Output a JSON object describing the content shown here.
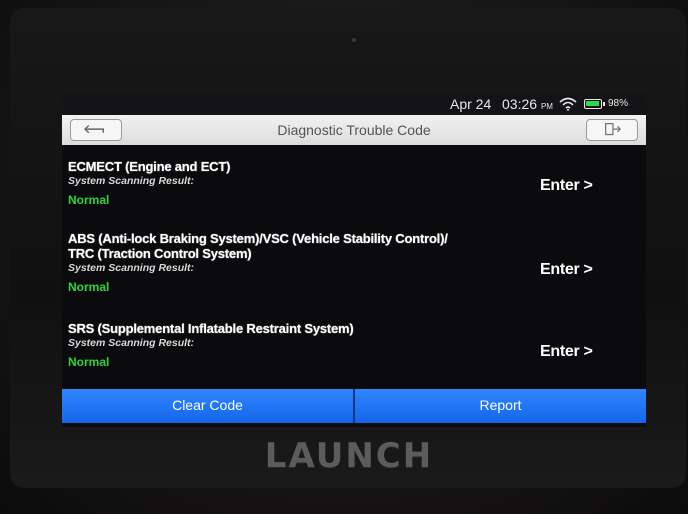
{
  "status_bar": {
    "date": "Apr 24",
    "time": "03:26",
    "time_suffix": "PM",
    "battery_level_percent": 98,
    "battery_label": "98%"
  },
  "header": {
    "title": "Diagnostic Trouble Code",
    "back_icon": "back-arrow-icon",
    "exit_icon": "exit-icon"
  },
  "systems": [
    {
      "name_lines": [
        "ECMECT (Engine and ECT)"
      ],
      "result_label": "System Scanning Result:",
      "result": "Normal",
      "enter_label": "Enter >"
    },
    {
      "name_lines": [
        "ABS (Anti-lock Braking System)/VSC (Vehicle Stability Control)/",
        "TRC (Traction Control System)"
      ],
      "result_label": "System Scanning Result:",
      "result": "Normal",
      "enter_label": "Enter >"
    },
    {
      "name_lines": [
        "SRS (Supplemental Inflatable Restraint System)"
      ],
      "result_label": "System Scanning Result:",
      "result": "Normal",
      "enter_label": "Enter >"
    }
  ],
  "footer": {
    "clear_code_label": "Clear Code",
    "report_label": "Report"
  },
  "device": {
    "brand": "LAUNCH"
  },
  "colors": {
    "accent_blue": "#1f76f5",
    "status_normal": "#2fd33b"
  }
}
